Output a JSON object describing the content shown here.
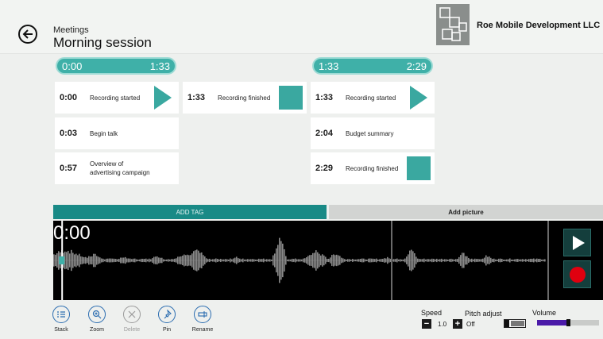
{
  "header": {
    "breadcrumb": "Meetings",
    "title": "Morning session",
    "company": "Roe Mobile Development LLC"
  },
  "segments": [
    {
      "start": "0:00",
      "end": "1:33"
    },
    {
      "start": "1:33",
      "end": "2:29"
    }
  ],
  "tags": [
    {
      "time": "0:00",
      "label": "Recording started",
      "action": "play"
    },
    {
      "time": "0:03",
      "label": "Begin talk",
      "action": ""
    },
    {
      "time": "0:57",
      "label": "Overview of advertising campaign",
      "action": ""
    },
    {
      "time": "1:33",
      "label": "Recording finished",
      "action": "stop"
    },
    {
      "time": "1:33",
      "label": "Recording started",
      "action": "play"
    },
    {
      "time": "2:04",
      "label": "Budget summary",
      "action": ""
    },
    {
      "time": "2:29",
      "label": "Recording finished",
      "action": "stop"
    }
  ],
  "buttons": {
    "add_tag": "ADD TAG",
    "add_picture": "Add picture"
  },
  "waveform": {
    "current_time": "0:00",
    "playhead_fraction": 0.01
  },
  "toolbar": [
    {
      "label": "Stack",
      "icon": "stack-icon",
      "enabled": true
    },
    {
      "label": "Zoom",
      "icon": "zoom-icon",
      "enabled": true
    },
    {
      "label": "Delete",
      "icon": "delete-icon",
      "enabled": false
    },
    {
      "label": "Pin",
      "icon": "pin-icon",
      "enabled": true
    },
    {
      "label": "Rename",
      "icon": "rename-icon",
      "enabled": true
    }
  ],
  "playback": {
    "speed_label": "Speed",
    "speed_value": "1.0",
    "pitch_label": "Pitch adjust",
    "pitch_value": "Off",
    "volume_label": "Volume",
    "volume_fraction": 0.5
  },
  "colors": {
    "accent": "#3fb0a8",
    "accent_dark": "#198a86",
    "record": "#e0000f",
    "volume": "#4a1aa8"
  }
}
